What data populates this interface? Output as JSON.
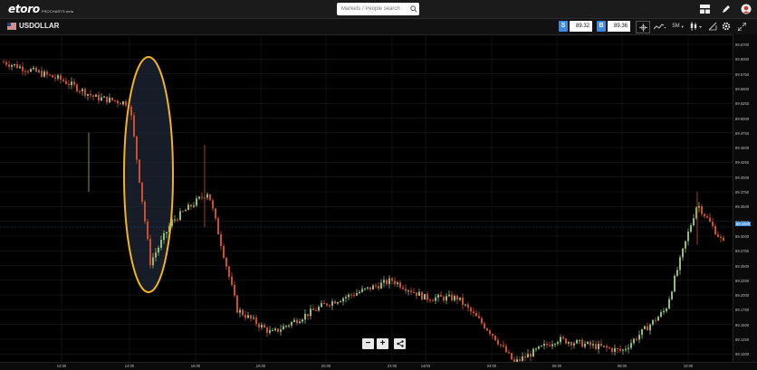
{
  "header": {
    "logo_main": "etoro",
    "logo_sub": "PROCHARTS beta",
    "search": {
      "placeholder": "Markets / People search"
    }
  },
  "toolbar": {
    "symbol": "USDOLLAR",
    "sell_tag": "S",
    "sell_price": "89.32",
    "buy_tag": "B",
    "buy_price": "89.36",
    "timeframe": "5M"
  },
  "colors": {
    "bull": "#8fbc72",
    "bear": "#d04d2c",
    "highlight": "#f2b320",
    "sell": "#3c8be0",
    "buy": "#3c8be0"
  },
  "y_axis_labels": [
    "89.6700",
    "89.6000",
    "89.5750",
    "89.5500",
    "89.5250",
    "89.5000",
    "89.4750",
    "89.4500",
    "89.4250",
    "89.4000",
    "89.3750",
    "89.3500",
    "89.3250",
    "89.3000",
    "89.2750",
    "89.2500",
    "89.2250",
    "89.2000",
    "89.1750",
    "89.1500",
    "89.1250",
    "89.1000"
  ],
  "current_price_label": "89.3300",
  "x_axis_labels": [
    "12:00",
    "14:00",
    "16:00",
    "18:00",
    "20:00",
    "22:00",
    "14/03",
    "04:00",
    "06:00",
    "08:00",
    "10:00"
  ],
  "zoom": {
    "minus": "−",
    "plus": "+",
    "share": "share"
  },
  "chart_data": {
    "type": "candlestick",
    "timeframe": "5M",
    "ylim": [
      89.1,
      89.68
    ],
    "x_range": [
      "11:00",
      "11:40 next day"
    ],
    "grid": true,
    "annotations": [
      "yellow ellipse around sharp drop near 14:30"
    ],
    "approx_price_path": [
      {
        "time": "11:00",
        "price": 89.64
      },
      {
        "time": "12:00",
        "price": 89.61
      },
      {
        "time": "13:00",
        "price": 89.58
      },
      {
        "time": "14:00",
        "price": 89.57
      },
      {
        "time": "14:30",
        "price": 89.3
      },
      {
        "time": "15:30",
        "price": 89.37
      },
      {
        "time": "16:30",
        "price": 89.42
      },
      {
        "time": "17:30",
        "price": 89.22
      },
      {
        "time": "18:30",
        "price": 89.18
      },
      {
        "time": "20:00",
        "price": 89.23
      },
      {
        "time": "22:00",
        "price": 89.27
      },
      {
        "time": "14/03 00:00",
        "price": 89.24
      },
      {
        "time": "02:00",
        "price": 89.24
      },
      {
        "time": "04:00",
        "price": 89.18
      },
      {
        "time": "05:00",
        "price": 89.13
      },
      {
        "time": "06:00",
        "price": 89.17
      },
      {
        "time": "08:00",
        "price": 89.15
      },
      {
        "time": "09:30",
        "price": 89.22
      },
      {
        "time": "10:00",
        "price": 89.35
      },
      {
        "time": "10:30",
        "price": 89.4
      },
      {
        "time": "11:40",
        "price": 89.33
      }
    ]
  }
}
